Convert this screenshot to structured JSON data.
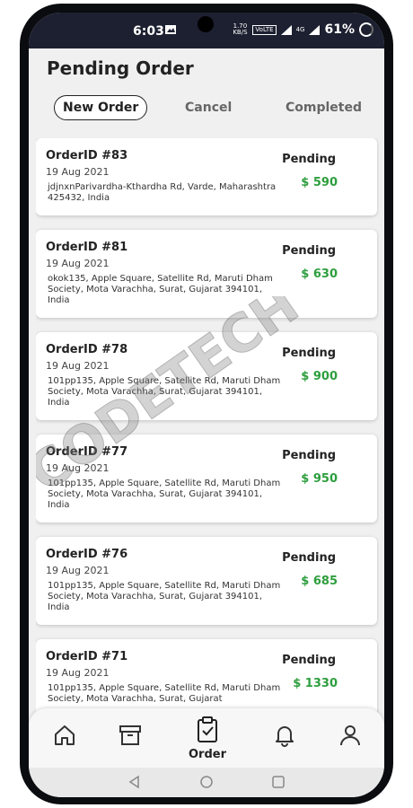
{
  "status": {
    "time": "6:03",
    "speed": "1.70 KB/S",
    "volte": "VoLTE",
    "network": "4G",
    "battery": "61%"
  },
  "page": {
    "title": "Pending Order"
  },
  "tabs": [
    {
      "label": "New Order",
      "active": true
    },
    {
      "label": "Cancel",
      "active": false
    },
    {
      "label": "Completed",
      "active": false
    }
  ],
  "orders": [
    {
      "id": "OrderID #83",
      "date": "19 Aug 2021",
      "address": "jdjnxnParivardha-Kthardha Rd, Varde, Maharashtra 425432, India",
      "status": "Pending",
      "amount": "$ 590"
    },
    {
      "id": "OrderID #81",
      "date": "19 Aug 2021",
      "address": "okok135, Apple Square, Satellite Rd, Maruti Dham Society, Mota Varachha, Surat, Gujarat 394101, India",
      "status": "Pending",
      "amount": "$ 630"
    },
    {
      "id": "OrderID #78",
      "date": "19 Aug 2021",
      "address": "101pp135, Apple Square, Satellite Rd, Maruti Dham Society, Mota Varachha, Surat, Gujarat 394101, India",
      "status": "Pending",
      "amount": "$ 900"
    },
    {
      "id": "OrderID #77",
      "date": "19 Aug 2021",
      "address": "101pp135, Apple Square, Satellite Rd, Maruti Dham Society, Mota Varachha, Surat, Gujarat 394101, India",
      "status": "Pending",
      "amount": "$ 950"
    },
    {
      "id": "OrderID #76",
      "date": "19 Aug 2021",
      "address": "101pp135, Apple Square, Satellite Rd, Maruti Dham Society, Mota Varachha, Surat, Gujarat 394101, India",
      "status": "Pending",
      "amount": "$ 685"
    },
    {
      "id": "OrderID #71",
      "date": "19 Aug 2021",
      "address": "101pp135, Apple Square, Satellite Rd, Maruti Dham Society, Mota Varachha, Surat, Gujarat",
      "status": "Pending",
      "amount": "$ 1330"
    }
  ],
  "bottom_nav": {
    "order_label": "Order"
  },
  "watermark": "CODETECH",
  "colors": {
    "amount": "#2e9e3e",
    "status_bar": "#1c2030"
  }
}
